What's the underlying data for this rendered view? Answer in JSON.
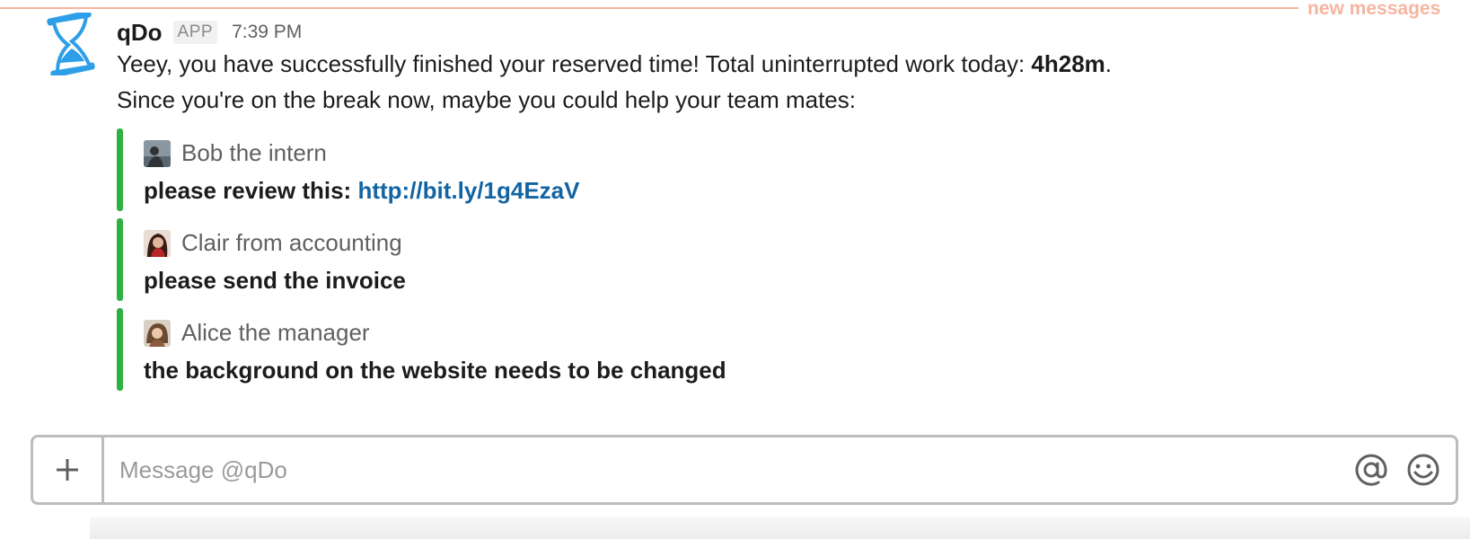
{
  "divider": {
    "label": "new messages",
    "color": "#f6b4a0"
  },
  "message": {
    "sender": "qDo",
    "badge": "APP",
    "time": "7:39 PM",
    "line1_text": "Yeey, you have successfully finished your reserved time! Total uninterrupted work today: ",
    "line1_bold": "4h28m",
    "line1_end": ".",
    "line2_text": "Since you're on the break now, maybe you could help your team mates:"
  },
  "attachments": [
    {
      "author": "Bob the intern",
      "text": "please review this: ",
      "link": "http://bit.ly/1g4EzaV"
    },
    {
      "author": "Clair from accounting",
      "text": "please send the invoice"
    },
    {
      "author": "Alice the manager",
      "text": "the background on the website needs to be changed"
    }
  ],
  "composer": {
    "placeholder": "Message @qDo",
    "plus_icon": "plus-icon",
    "at_icon": "at-sign-icon",
    "emoji_icon": "smiley-icon"
  },
  "colors": {
    "accent_bar": "#2eb042",
    "link": "#1264a3",
    "app_icon": "#2d9ee8"
  }
}
